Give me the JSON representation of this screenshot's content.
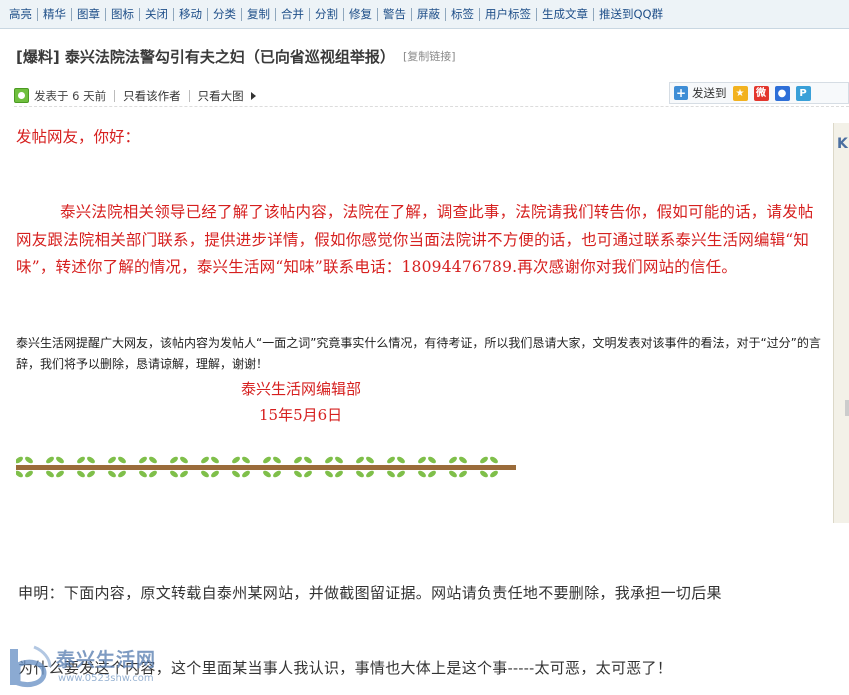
{
  "toolbar": {
    "items": [
      "高亮",
      "精华",
      "图章",
      "图标",
      "关闭",
      "移动",
      "分类",
      "复制",
      "合并",
      "分割",
      "修复",
      "警告",
      "屏蔽",
      "标签",
      "用户标签",
      "生成文章",
      "推送到QQ群"
    ]
  },
  "post": {
    "title": "[爆料] 泰兴法院法警勾引有夫之妇（已向省巡视组举报）",
    "copy_link": "[复制链接]",
    "meta": {
      "posted": "发表于 6 天前",
      "only_author": "只看该作者",
      "big_image": "只看大图"
    },
    "share": {
      "label": "发送到",
      "icons": [
        "qzone-icon",
        "weibo-icon",
        "baidu-icon",
        "qq-icon"
      ]
    }
  },
  "content": {
    "greeting": "发帖网友，你好：",
    "paragraph": "泰兴法院相关领导已经了解了该帖内容，法院在了解，调查此事，法院请我们转告你，假如可能的话，请发帖网友跟法院相关部门联系，提供进步详情，假如你感觉你当面法院讲不方便的话，也可通过联系泰兴生活网编辑“知味”，转述你了解的情况，泰兴生活网“知味”联系电话：18094476789.再次感谢你对我们网站的信任。",
    "notice": "泰兴生活网提醒广大网友，该帖内容为发帖人“一面之词”究竟事实什么情况，有待考证，所以我们恳请大家，文明发表对该事件的看法，对于“过分”的言辞，我们将予以删除，恳请谅解，理解，谢谢！",
    "signature_org": "泰兴生活网编辑部",
    "signature_date": "15年5月6日",
    "side_letter": "K",
    "declaration": "申明：下面内容，原文转载自泰州某网站，并做截图留证据。网站请负责任地不要删除，我承担一切后果",
    "bottom_text": "为什么要发这个内容，这个里面某当事人我认识，事情也大体上是这个事-----太可恶，太可恶了！"
  },
  "watermark": {
    "name": "泰兴生活网",
    "url": "www.0523shw.com"
  },
  "colors": {
    "toolbar_bg": "#edf3f7",
    "toolbar_text": "#20508a",
    "red_text": "#d6201f",
    "vine_brown": "#9a6b3a",
    "leaf_green": "#7fbf4a"
  }
}
